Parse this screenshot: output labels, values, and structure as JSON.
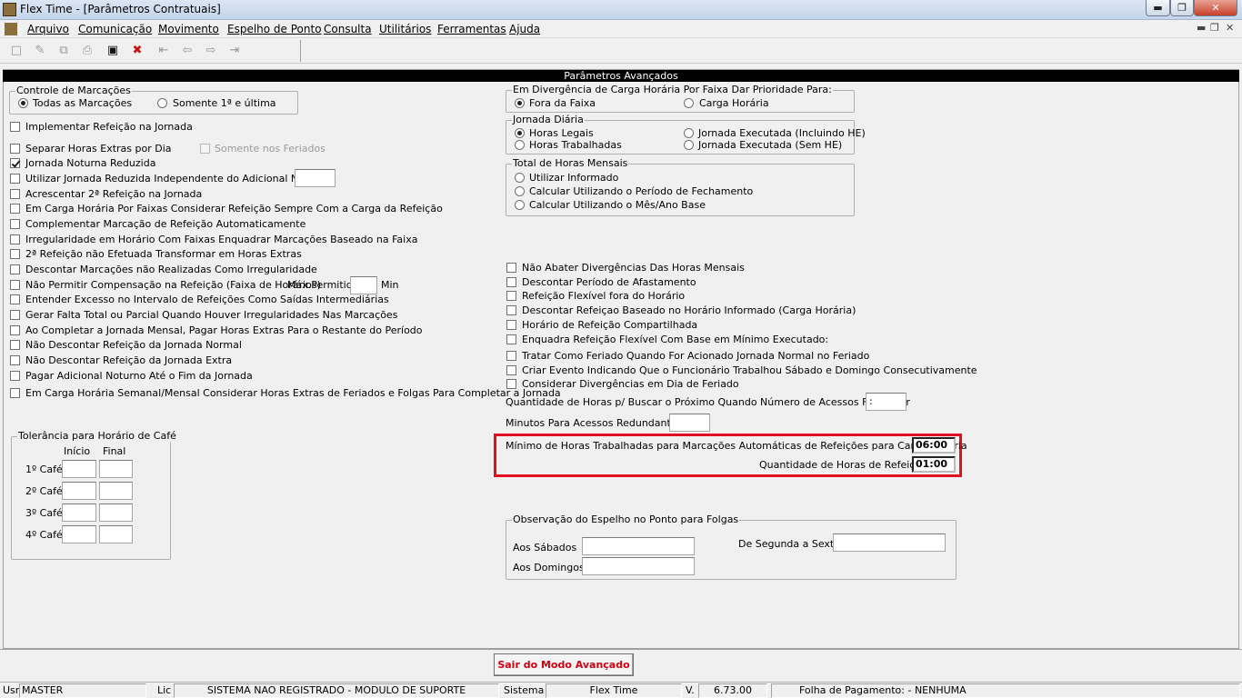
{
  "window": {
    "title": "Flex Time - [Parâmetros Contratuais]",
    "min_icon": "minimize-icon",
    "max_icon": "maximize-icon",
    "close_icon": "close-icon"
  },
  "menu": [
    "Arquivo",
    "Comunicação",
    "Movimento",
    "Espelho de Ponto",
    "Consulta",
    "Utilitários",
    "Ferramentas",
    "Ajuda"
  ],
  "toolbar_icons": [
    "new-record-icon",
    "edit-record-icon",
    "copy-record-icon",
    "print-icon",
    "save-icon",
    "delete-icon",
    "first-record-icon",
    "prev-record-icon",
    "next-record-icon",
    "last-record-icon"
  ],
  "header": "Parâmetros Avançados",
  "controle": {
    "title": "Controle de Marcações",
    "opt1": "Todas as Marcações",
    "opt2": "Somente 1ª e última"
  },
  "left_checks": [
    "Implementar Refeição na Jornada",
    "Separar Horas Extras por Dia",
    "Jornada Noturna Reduzida",
    "Utilizar Jornada Reduzida Independente do Adicional Noturno",
    "Acrescentar 2ª Refeição na Jornada",
    "Em Carga Horária Por Faixas Considerar Refeição Sempre Com a Carga da Refeição",
    "Complementar Marcação de Refeição Automaticamente",
    "Irregularidade em Horário Com Faixas Enquadrar Marcações Baseado na Faixa",
    "2ª Refeição não Efetuada Transformar em Horas Extras",
    "Descontar Marcações não Realizadas Como Irregularidade",
    "Não Permitir Compensação na Refeição (Faixa de Horários)",
    "Entender Excesso no Intervalo de Refeições Como Saídas Intermediárias",
    "Gerar Falta Total ou Parcial Quando Houver Irregularidades Nas Marcações",
    "Ao Completar a Jornada Mensal, Pagar Horas Extras Para o Restante do Período",
    "Não Descontar Refeição da Jornada Normal",
    "Não Descontar Refeição da Jornada Extra",
    "Pagar Adicional Noturno Até o Fim da Jornada",
    "Em Carga Horária Semanal/Mensal Considerar Horas Extras de Feriados e Folgas Para Completar a Jornada"
  ],
  "somente_feriados": "Somente nos Feriados",
  "max_permitido": "Máx.Permitido",
  "min_label": "Min",
  "cafe": {
    "title": "Tolerância para Horário de Café",
    "inicio": "Início",
    "final": "Final",
    "rows": [
      "1º Café",
      "2º Café",
      "3º Café",
      "4º Café"
    ]
  },
  "divergencia": {
    "title": "Em Divergência de Carga Horária Por Faixa Dar Prioridade Para:",
    "opt1": "Fora da Faixa",
    "opt2": "Carga Horária"
  },
  "jornada": {
    "title": "Jornada Diária",
    "opt1": "Horas Legais",
    "opt2": "Horas Trabalhadas",
    "opt3": "Jornada Executada (Incluindo HE)",
    "opt4": "Jornada Executada (Sem HE)"
  },
  "total": {
    "title": "Total de Horas Mensais",
    "opt1": "Utilizar Informado",
    "opt2": "Calcular Utilizando o Período de Fechamento",
    "opt3": "Calcular Utilizando o Mês/Ano Base"
  },
  "right_checks": [
    "Não Abater Divergências Das Horas Mensais",
    "Descontar Período de Afastamento",
    "Refeição Flexível fora do Horário",
    "Descontar Refeiçao Baseado no Horário Informado (Carga Horária)",
    "Horário de Refeição Compartilhada",
    "Enquadra Refeição Flexível Com Base em Mínimo Executado:",
    "Tratar Como Feriado Quando For Acionado Jornada Normal no Feriado",
    "Criar Evento Indicando Que o Funcionário Trabalhou Sábado e Domingo Consecutivamente",
    "Considerar Divergências em Dia de Feriado"
  ],
  "qtd_horas_label": "Quantidade de Horas p/ Buscar o Próximo Quando Número de Acessos For Impar",
  "qtd_horas_value": " :",
  "minutos_label": "Minutos Para Acessos Redundantes:",
  "minimo_label": "Mínimo de Horas Trabalhadas para Marcações Automáticas de Refeições para Carga Horária",
  "minimo_value": "06:00",
  "qtd_refeicao_label": "Quantidade de Horas de Refeição",
  "qtd_refeicao_value": "01:00",
  "obs": {
    "title": "Observação do Espelho no Ponto para Folgas",
    "sabados": "Aos Sábados",
    "domingos": "Aos Domingos",
    "seg_sex": "De Segunda a Sexta"
  },
  "sair_button": "Sair do Modo Avançado",
  "status": {
    "usr_label": "Usr",
    "usr": "MASTER",
    "lic_label": "Lic",
    "lic": "SISTEMA NAO REGISTRADO - MODULO DE SUPORTE",
    "sistema_label": "Sistema",
    "sistema": "Flex Time",
    "v_label": "V.",
    "version": "6.73.00",
    "folha": "Folha de Pagamento:  - NENHUMA"
  }
}
